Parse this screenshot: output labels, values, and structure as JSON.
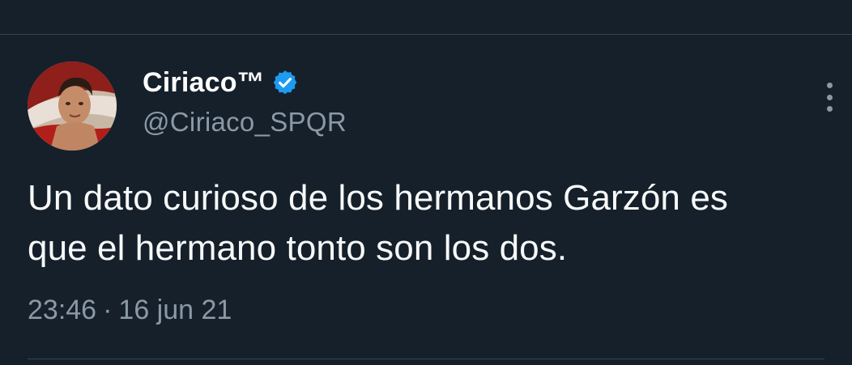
{
  "tweet": {
    "display_name": "Ciriaco™",
    "handle": "@Ciriaco_SPQR",
    "verified": true,
    "text_line_1": "Un dato curioso de los hermanos Garzón es",
    "text_line_2": "que el hermano tonto son los dos.",
    "time": "23:46",
    "separator": "·",
    "date": "16 jun 21"
  },
  "icons": {
    "verified": "verified-badge-icon",
    "more": "more-vertical-icon",
    "avatar": "avatar"
  },
  "colors": {
    "background": "#15202b",
    "divider": "#38444d",
    "primary_text": "#f7f9f9",
    "secondary_text": "#8b98a5",
    "verified_blue": "#1d9bf0"
  }
}
